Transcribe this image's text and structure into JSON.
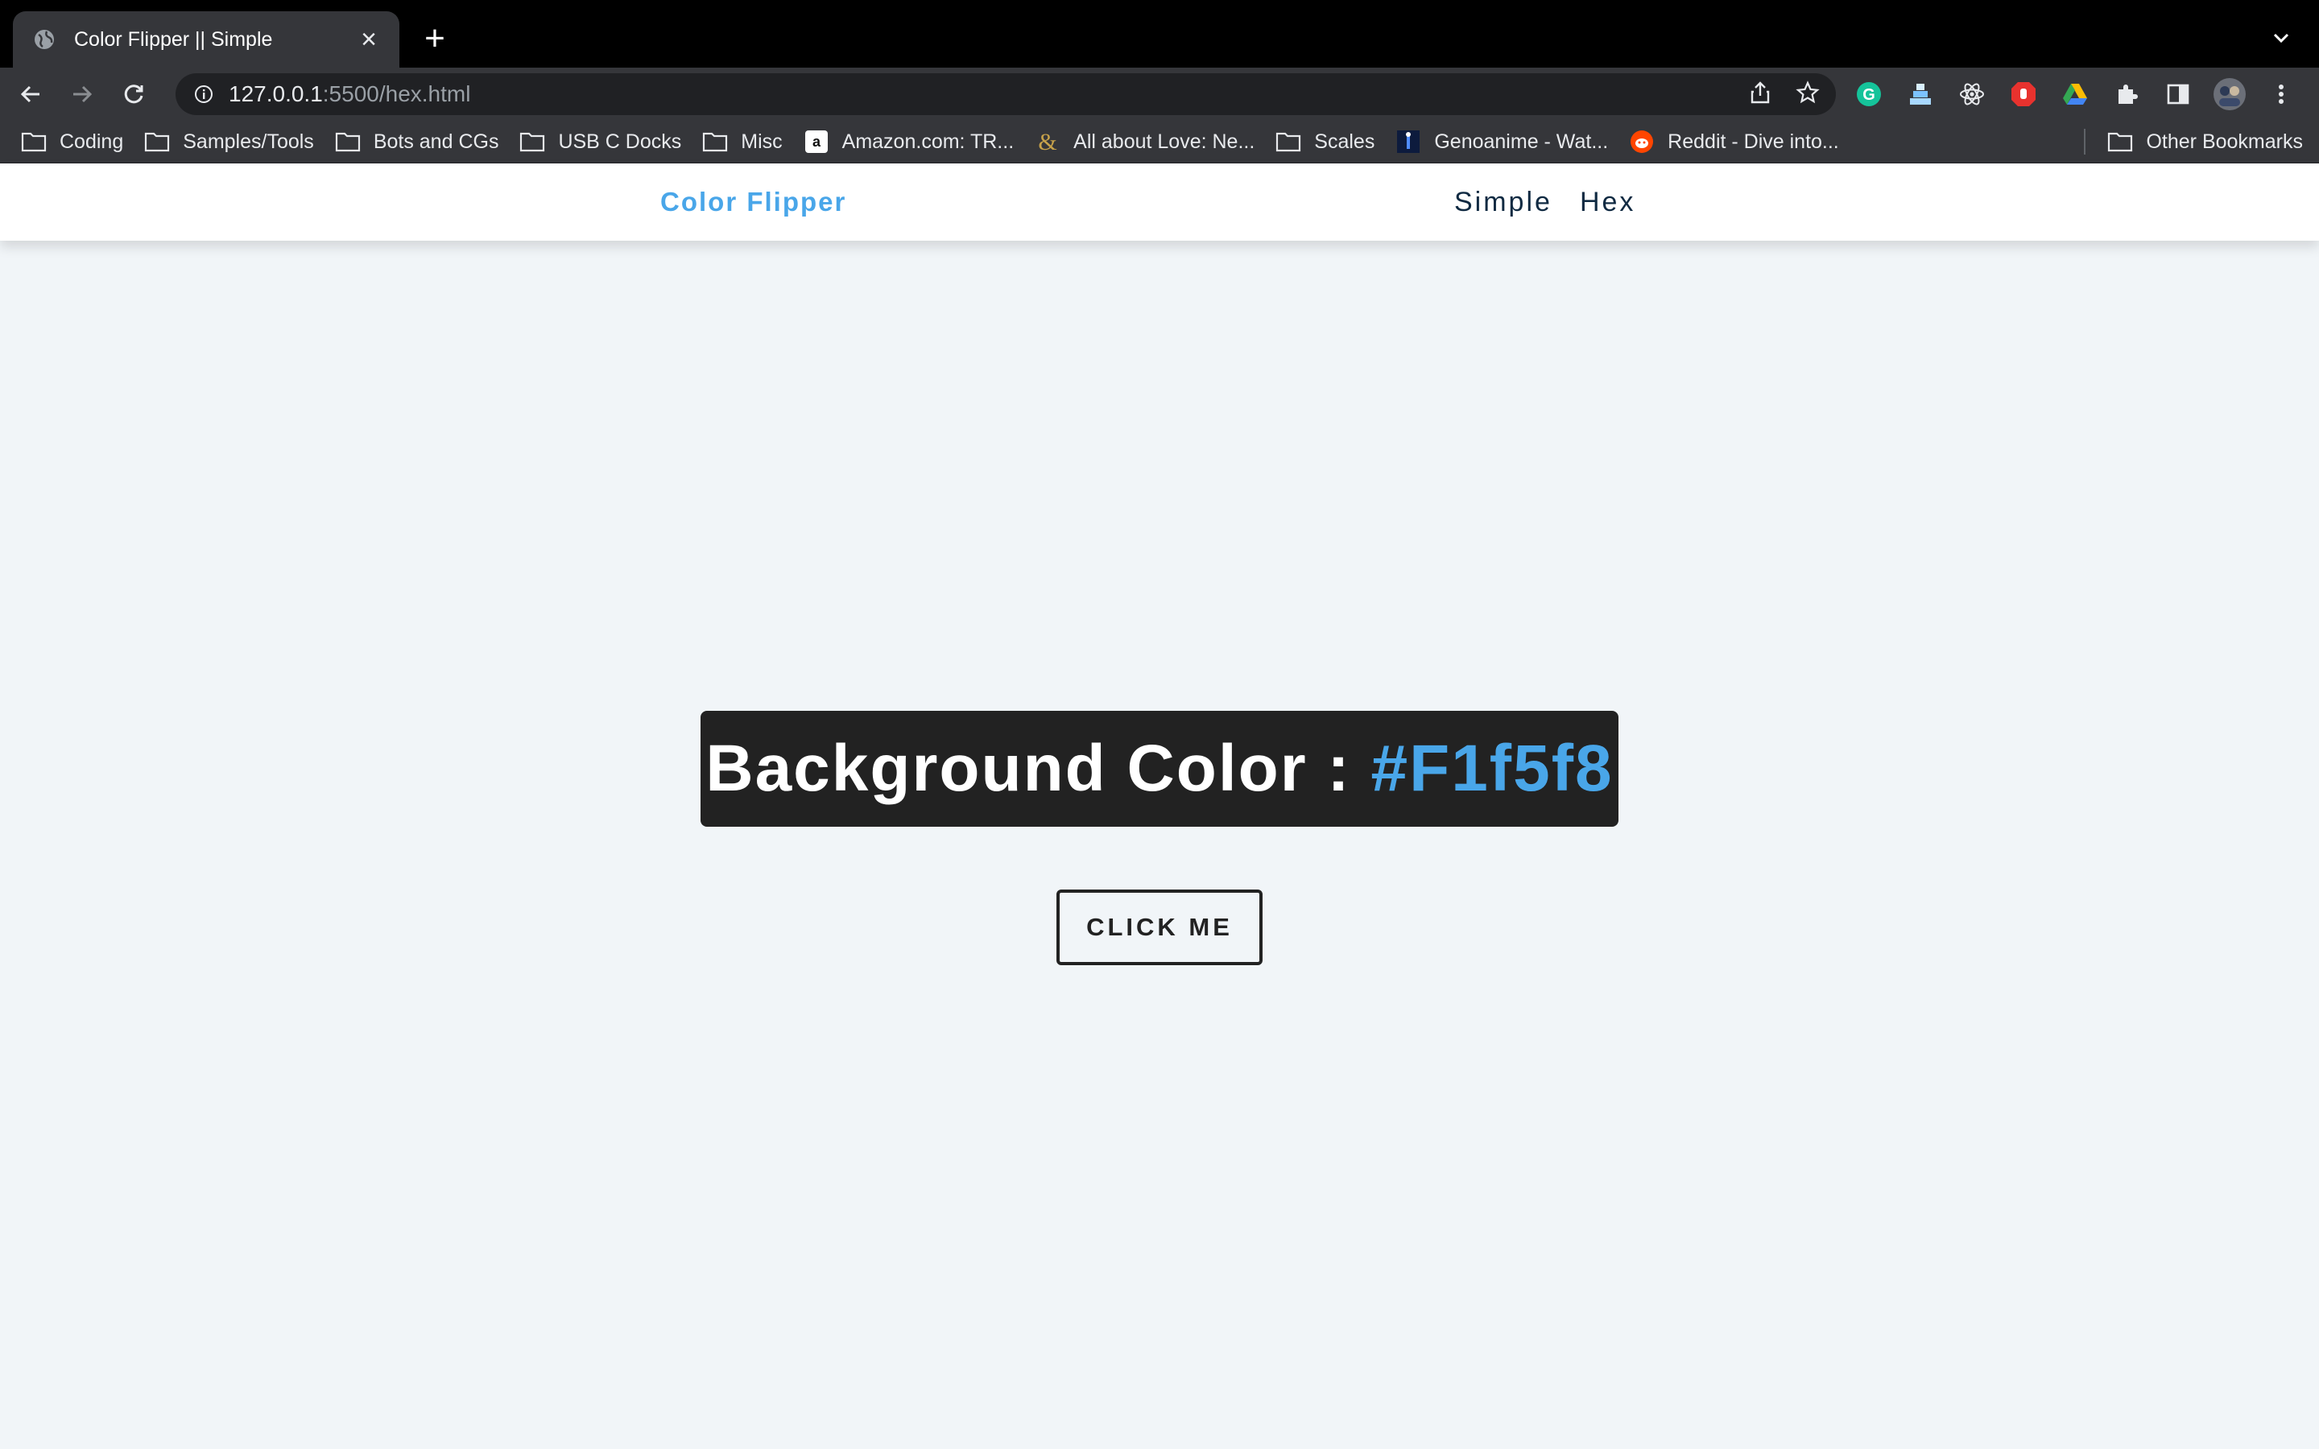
{
  "browser": {
    "tab_title": "Color Flipper || Simple",
    "url_host": "127.0.0.1",
    "url_rest": ":5500/hex.html",
    "bookmarks": [
      {
        "label": "Coding",
        "icon": "folder-icon"
      },
      {
        "label": "Samples/Tools",
        "icon": "folder-icon"
      },
      {
        "label": "Bots and CGs",
        "icon": "folder-icon"
      },
      {
        "label": "USB C Docks",
        "icon": "folder-icon"
      },
      {
        "label": "Misc",
        "icon": "folder-icon"
      },
      {
        "label": "Amazon.com: TR...",
        "icon": "amazon-icon"
      },
      {
        "label": "All about Love: Ne...",
        "icon": "ampersand-icon"
      },
      {
        "label": "Scales",
        "icon": "folder-icon"
      },
      {
        "label": "Genoanime - Wat...",
        "icon": "genoanime-icon"
      },
      {
        "label": "Reddit - Dive into...",
        "icon": "reddit-icon"
      }
    ],
    "other_bookmarks": "Other Bookmarks"
  },
  "site": {
    "brand": "Color Flipper",
    "nav_links": [
      "Simple",
      "Hex"
    ],
    "heading_prefix": "Background Color : ",
    "color_value": "#F1f5f8",
    "button_label": "click me"
  },
  "colors": {
    "background": "#f1f5f8",
    "accent": "#49a6e9",
    "dark": "#222222"
  }
}
